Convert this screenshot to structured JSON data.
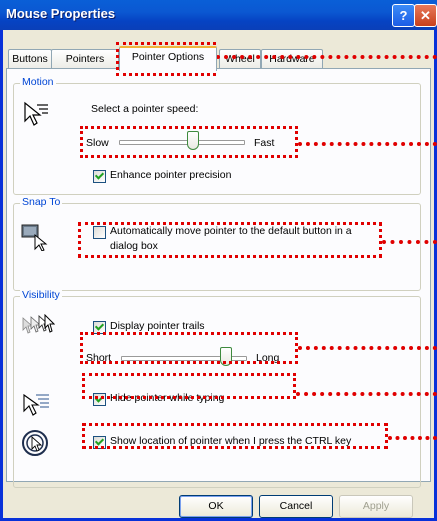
{
  "window": {
    "title": "Mouse Properties",
    "help_glyph": "?",
    "close_glyph": "✕"
  },
  "tabs": [
    {
      "label": "Buttons"
    },
    {
      "label": "Pointers"
    },
    {
      "label": "Pointer Options",
      "active": true
    },
    {
      "label": "Wheel"
    },
    {
      "label": "Hardware"
    }
  ],
  "motion": {
    "group_label": "Motion",
    "speed_label": "Select a pointer speed:",
    "slow_label": "Slow",
    "fast_label": "Fast",
    "speed_level": 0.6,
    "precision_label": "Enhance pointer precision",
    "precision_checked": true
  },
  "snap": {
    "group_label": "Snap To",
    "auto_label_line1": "Automatically move pointer to the default button in a",
    "auto_label_line2": "dialog box",
    "auto_checked": false
  },
  "visibility": {
    "group_label": "Visibility",
    "trails_label": "Display pointer trails",
    "trails_checked": true,
    "short_label": "Short",
    "long_label": "Long",
    "trail_level": 0.85,
    "hide_label": "Hide pointer while typing",
    "hide_checked": true,
    "ctrl_label": "Show location of pointer when I press the CTRL key",
    "ctrl_checked": true
  },
  "buttons": {
    "ok": "OK",
    "cancel": "Cancel",
    "apply": "Apply"
  },
  "colors": {
    "title_bar": "#0a5fd7",
    "highlight": "#e00000",
    "group_label": "#0046d5",
    "dialog_bg": "#ece9d8"
  },
  "icons": [
    "help-icon",
    "close-icon",
    "mouse-pointer-speed-icon",
    "snap-to-icon",
    "pointer-trails-icon",
    "hide-pointer-icon",
    "ctrl-locate-icon"
  ]
}
